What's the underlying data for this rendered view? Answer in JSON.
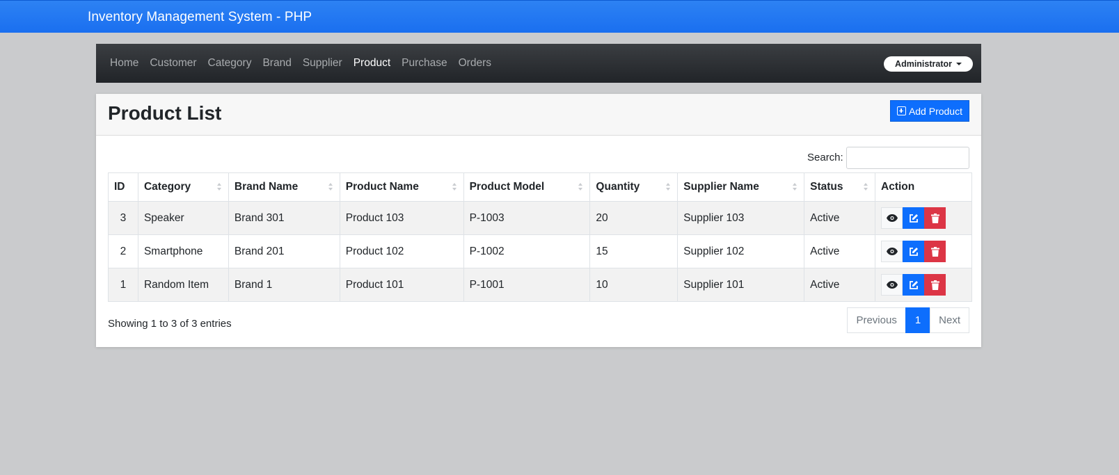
{
  "header": {
    "title": "Inventory Management System - PHP"
  },
  "nav": {
    "items": [
      {
        "label": "Home",
        "active": false
      },
      {
        "label": "Customer",
        "active": false
      },
      {
        "label": "Category",
        "active": false
      },
      {
        "label": "Brand",
        "active": false
      },
      {
        "label": "Supplier",
        "active": false
      },
      {
        "label": "Product",
        "active": true
      },
      {
        "label": "Purchase",
        "active": false
      },
      {
        "label": "Orders",
        "active": false
      }
    ],
    "user_menu": "Administrator"
  },
  "card": {
    "title": "Product List",
    "add_button_label": "Add Product",
    "search_label": "Search:",
    "search_value": ""
  },
  "table": {
    "columns": [
      "ID",
      "Category",
      "Brand Name",
      "Product Name",
      "Product Model",
      "Quantity",
      "Supplier Name",
      "Status",
      "Action"
    ],
    "rows": [
      {
        "id": "3",
        "category": "Speaker",
        "brand": "Brand 301",
        "product": "Product 103",
        "model": "P-1003",
        "quantity": "20",
        "supplier": "Supplier 103",
        "status": "Active"
      },
      {
        "id": "2",
        "category": "Smartphone",
        "brand": "Brand 201",
        "product": "Product 102",
        "model": "P-1002",
        "quantity": "15",
        "supplier": "Supplier 102",
        "status": "Active"
      },
      {
        "id": "1",
        "category": "Random Item",
        "brand": "Brand 1",
        "product": "Product 101",
        "model": "P-1001",
        "quantity": "10",
        "supplier": "Supplier 101",
        "status": "Active"
      }
    ]
  },
  "footer": {
    "info": "Showing 1 to 3 of 3 entries",
    "pagination": {
      "previous": "Previous",
      "current": "1",
      "next": "Next"
    }
  },
  "colors": {
    "primary": "#0d6efd",
    "danger": "#dc3545",
    "header": "#1a6ff0"
  },
  "icons": {
    "add": "plus-square-icon",
    "view": "eye-icon",
    "edit": "edit-icon",
    "delete": "trash-icon"
  }
}
